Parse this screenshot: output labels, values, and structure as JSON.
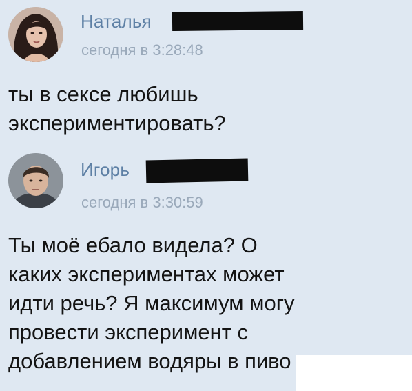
{
  "messages": [
    {
      "author": "Наталья",
      "time": "сегодня в 3:28:48",
      "text": "ты в сексе любишь\nэкспериментировать?"
    },
    {
      "author": "Игорь",
      "time": "сегодня в 3:30:59",
      "text": "Ты моё ебало видела? О\nкаких экспериментах  может\nидти речь? Я максимум могу\nпровести эксперимент с\nдобавлением водяры в пиво"
    }
  ],
  "colors": {
    "background": "#dfe8f2",
    "author": "#5e80a5",
    "time": "#9aa9ba",
    "text": "#141414",
    "redaction": "#0d0d0d"
  }
}
